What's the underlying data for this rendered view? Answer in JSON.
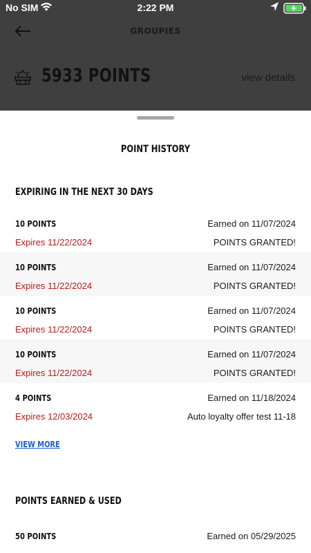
{
  "status_bar": {
    "carrier": "No SIM",
    "time": "2:22 PM"
  },
  "header": {
    "title": "GROUPIES"
  },
  "points": {
    "value": "5933 POINTS",
    "details_link": "view details"
  },
  "sheet": {
    "title": "POINT HISTORY",
    "expiring": {
      "heading": "EXPIRING IN THE NEXT 30 DAYS",
      "rows": [
        {
          "points": "10 POINTS",
          "earned": "Earned on 11/07/2024",
          "expires": "Expires 11/22/2024",
          "status": "POINTS GRANTED!"
        },
        {
          "points": "10 POINTS",
          "earned": "Earned on 11/07/2024",
          "expires": "Expires 11/22/2024",
          "status": "POINTS GRANTED!"
        },
        {
          "points": "10 POINTS",
          "earned": "Earned on 11/07/2024",
          "expires": "Expires 11/22/2024",
          "status": "POINTS GRANTED!"
        },
        {
          "points": "10 POINTS",
          "earned": "Earned on 11/07/2024",
          "expires": "Expires 11/22/2024",
          "status": "POINTS GRANTED!"
        },
        {
          "points": "4 POINTS",
          "earned": "Earned on 11/18/2024",
          "expires": "Expires 12/03/2024",
          "status": "Auto loyalty offer test 11-18"
        }
      ],
      "view_more": "VIEW MORE"
    },
    "earned_used": {
      "heading": "POINTS EARNED & USED",
      "rows": [
        {
          "points": "50 POINTS",
          "earned": "Earned on 05/29/2025"
        }
      ]
    }
  },
  "colors": {
    "expires_red": "#b71c1c",
    "link_blue": "#1a5ed0",
    "overlay_gray": "#3f3f3f"
  }
}
